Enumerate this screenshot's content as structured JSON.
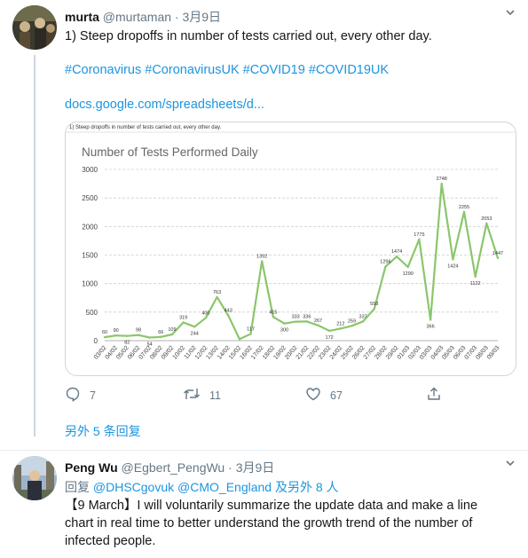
{
  "tweet1": {
    "name": "murta",
    "handle": "@murtaman",
    "dot": "·",
    "date": "3月9日",
    "text": "1) Steep dropoffs in number of tests carried out, every other day.",
    "hashtags": "#Coronavirus #CoronavirusUK #COVID19 #COVID19UK",
    "link": "docs.google.com/spreadsheets/d...",
    "reply_count": "7",
    "retweet_count": "11",
    "like_count": "67",
    "more_replies": "另外 5 条回复"
  },
  "chart_data": {
    "type": "line",
    "caption": "1)  Steep dropoffs in number of tests carried out, every other day.",
    "title": "Number of Tests Performed Daily",
    "ylim": [
      0,
      3000
    ],
    "yticks": [
      0,
      500,
      1000,
      1500,
      2000,
      2500,
      3000
    ],
    "grid": true,
    "color": "#8bc66b",
    "categories": [
      "03/02",
      "04/02",
      "05/02",
      "06/02",
      "07/02",
      "08/02",
      "09/02",
      "10/02",
      "11/02",
      "12/02",
      "13/02",
      "14/02",
      "15/02",
      "16/02",
      "17/02",
      "18/02",
      "19/02",
      "20/02",
      "21/02",
      "22/02",
      "23/02",
      "24/02",
      "25/02",
      "26/02",
      "27/02",
      "28/02",
      "29/02",
      "01/03",
      "02/03",
      "03/03",
      "04/03",
      "05/03",
      "06/03",
      "07/03",
      "08/03",
      "09/03"
    ],
    "values": [
      60,
      90,
      82,
      98,
      54,
      66,
      109,
      319,
      244,
      400,
      763,
      443,
      28,
      117,
      1392,
      415,
      300,
      333,
      336,
      267,
      172,
      212,
      259,
      337,
      558,
      1296,
      1474,
      1290,
      1775,
      366,
      2748,
      1424,
      2255,
      1122,
      2053,
      1447
    ],
    "labels": [
      "60",
      "90",
      "82",
      "98",
      "54",
      "66",
      "109",
      "319",
      "244",
      "400",
      "763",
      "443",
      "",
      "117",
      "1392",
      "415",
      "300",
      "333",
      "336",
      "267",
      "172",
      "212",
      "259",
      "337",
      "558",
      "1296",
      "1474",
      "1290",
      "1775",
      "366",
      "2748",
      "1424",
      "2255",
      "1122",
      "2053",
      "1447"
    ]
  },
  "tweet2": {
    "name": "Peng Wu",
    "handle": "@Egbert_PengWu",
    "dot": "·",
    "date": "3月9日",
    "reply_prefix": "回复",
    "mention1": "@DHSCgovuk",
    "mention2": "@CMO_England",
    "mention_others": "及另外 8 人",
    "text_line1": "【9 March】I will voluntarily summarize the update data and make a line",
    "text_line2": "chart in real time to better understand the growth trend of the number of",
    "text_line3": "infected people."
  },
  "colors": {
    "link": "#1b95e0",
    "secondary": "#657786",
    "chart_line": "#8bc66b",
    "thread_line": "#ccd6dd"
  },
  "icons": {
    "reply": "reply-icon",
    "retweet": "retweet-icon",
    "like": "heart-icon",
    "share": "share-icon",
    "caret": "chevron-down-icon"
  }
}
